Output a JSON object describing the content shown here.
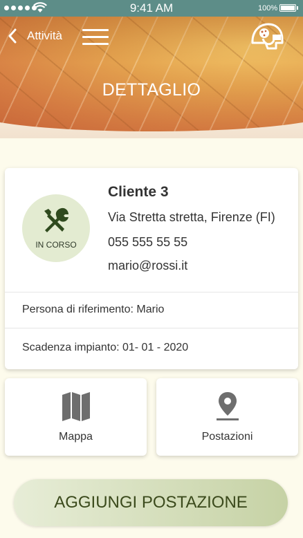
{
  "status_bar": {
    "time": "9:41 AM",
    "battery": "100%"
  },
  "header": {
    "back_label": "Attività",
    "title": "DETTAGLIO"
  },
  "client": {
    "status": "IN CORSO",
    "name": "Cliente 3",
    "address": "Via Stretta stretta, Firenze (FI)",
    "phone": "055 555 55 55",
    "email": "mario@rossi.it",
    "contact": "Persona di riferimento: Mario",
    "deadline": "Scadenza impianto: 01- 01 - 2020"
  },
  "tiles": [
    {
      "label": "Mappa",
      "icon": "map-icon"
    },
    {
      "label": "Postazioni",
      "icon": "location-pin-icon"
    }
  ],
  "add_button": {
    "label": "AGGIUNGI POSTAZIONE"
  },
  "colors": {
    "status_bar": "#5d8d88",
    "background": "#fdfbec",
    "status_circle": "#e3ebd1",
    "button_gradient_start": "#e7edd7",
    "button_gradient_end": "#c6d2a5",
    "button_text": "#3b4a1c",
    "icon_gray": "#6e6e6e"
  }
}
